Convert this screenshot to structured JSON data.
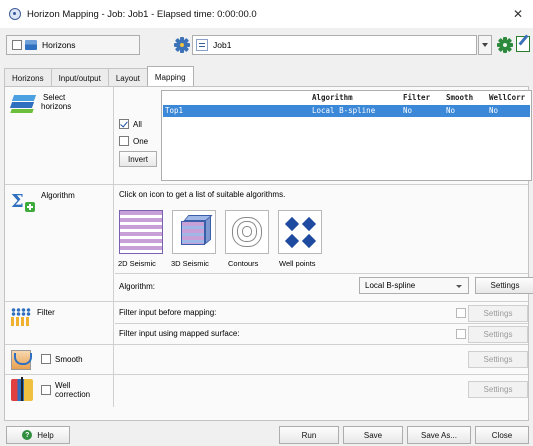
{
  "window": {
    "title": "Horizon Mapping - Job: Job1 - Elapsed time: 0:00:00.0",
    "close_icon": "close-icon"
  },
  "toolbar": {
    "horizons_label": "Horizons",
    "horizons_checked": false,
    "job_value": "Job1"
  },
  "tabs": [
    {
      "label": "Horizons",
      "active": false
    },
    {
      "label": "Input/output",
      "active": false
    },
    {
      "label": "Layout",
      "active": false
    },
    {
      "label": "Mapping",
      "active": true
    }
  ],
  "select_horizons": {
    "label_line1": "Select",
    "label_line2": "horizons",
    "all_label": "All",
    "all_checked": true,
    "one_label": "One",
    "one_checked": false,
    "invert_label": "Invert",
    "columns": [
      "Algorithm",
      "Filter",
      "Smooth",
      "WellCorr"
    ],
    "rows": [
      {
        "name": "Top1",
        "algorithm": "Local B-spline",
        "filter": "No",
        "smooth": "No",
        "wellcorr": "No"
      }
    ]
  },
  "algorithm": {
    "label": "Algorithm",
    "hint": "Click on icon to get a list of suitable algorithms.",
    "cards": [
      {
        "label": "2D Seismic",
        "icon": "2d-seismic-icon"
      },
      {
        "label": "3D Seismic",
        "icon": "3d-seismic-icon"
      },
      {
        "label": "Contours",
        "icon": "contours-icon"
      },
      {
        "label": "Well points",
        "icon": "well-points-icon"
      }
    ],
    "algorithm_label": "Algorithm:",
    "selected_algorithm": "Local B-spline",
    "settings_label": "Settings"
  },
  "filter": {
    "label": "Filter",
    "line1": "Filter input before mapping:",
    "line2": "Filter input using mapped surface:",
    "settings_label": "Settings"
  },
  "smooth": {
    "label": "Smooth",
    "settings_label": "Settings"
  },
  "well_correction": {
    "label_line1": "Well",
    "label_line2": "correction",
    "settings_label": "Settings"
  },
  "bottom": {
    "help_label": "Help",
    "run_label": "Run",
    "save_label": "Save",
    "save_as_label": "Save As...",
    "close_label": "Close"
  }
}
